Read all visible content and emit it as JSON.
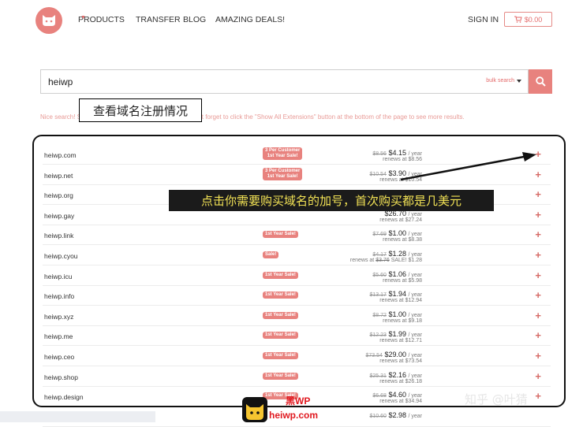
{
  "header": {
    "nav": [
      "PRODUCTS",
      "TRANSFER",
      "BLOG",
      "AMAZING DEALS!"
    ],
    "signin": "SIGN IN",
    "cart": "$0.00"
  },
  "search": {
    "value": "heiwp",
    "bulk_label": "bulk search"
  },
  "notice": "Nice search! Scroll down to see available domains or don't forget to click the \"Show All Extensions\" button at the bottom of the page to see more results.",
  "annotations": {
    "check_domain": "查看域名注册情况",
    "click_plus": "点击你需要购买域名的加号，首次购买都是几美元"
  },
  "rows": [
    {
      "domain": "heiwp.com",
      "badge": [
        "3 Per Customer",
        "1st Year Sale!"
      ],
      "old": "$8.56",
      "price": "$4.15",
      "unit": "/ year",
      "renew_prefix": "renews at ",
      "renew_old": "",
      "renew": "$8.56"
    },
    {
      "domain": "heiwp.net",
      "badge": [
        "3 Per Customer",
        "1st Year Sale!"
      ],
      "old": "$10.54",
      "price": "$3.90",
      "unit": "/ year",
      "renew_prefix": "renews at ",
      "renew_old": "",
      "renew": "$10.54"
    },
    {
      "domain": "heiwp.org",
      "badge": [],
      "old": "",
      "price": "",
      "unit": "",
      "renew_prefix": "",
      "renew_old": "",
      "renew": ""
    },
    {
      "domain": "heiwp.gay",
      "badge": [],
      "old": "",
      "price": "$26.70",
      "unit": "/ year",
      "renew_prefix": "renews at ",
      "renew_old": "",
      "renew": "$27.24"
    },
    {
      "domain": "heiwp.link",
      "badge": [
        "1st Year Sale!"
      ],
      "old": "$7.69",
      "price": "$1.00",
      "unit": "/ year",
      "renew_prefix": "renews at ",
      "renew_old": "",
      "renew": "$8.38"
    },
    {
      "domain": "heiwp.cyou",
      "badge": [
        "Sale!"
      ],
      "old": "$4.17",
      "price": "$1.28",
      "unit": "/ year",
      "renew_prefix": "renews at ",
      "renew_old": "$3.76",
      "renew": "SALE! $1.28"
    },
    {
      "domain": "heiwp.icu",
      "badge": [
        "1st Year Sale!"
      ],
      "old": "$5.60",
      "price": "$1.06",
      "unit": "/ year",
      "renew_prefix": "renews at ",
      "renew_old": "",
      "renew": "$5.98"
    },
    {
      "domain": "heiwp.info",
      "badge": [
        "1st Year Sale!"
      ],
      "old": "$13.17",
      "price": "$1.94",
      "unit": "/ year",
      "renew_prefix": "renews at ",
      "renew_old": "",
      "renew": "$12.94"
    },
    {
      "domain": "heiwp.xyz",
      "badge": [
        "1st Year Sale!"
      ],
      "old": "$8.72",
      "price": "$1.00",
      "unit": "/ year",
      "renew_prefix": "renews at ",
      "renew_old": "",
      "renew": "$9.18"
    },
    {
      "domain": "heiwp.me",
      "badge": [
        "1st Year Sale!"
      ],
      "old": "$12.23",
      "price": "$1.99",
      "unit": "/ year",
      "renew_prefix": "renews at ",
      "renew_old": "",
      "renew": "$12.71"
    },
    {
      "domain": "heiwp.ceo",
      "badge": [
        "1st Year Sale!"
      ],
      "old": "$73.54",
      "price": "$29.00",
      "unit": "/ year",
      "renew_prefix": "renews at ",
      "renew_old": "",
      "renew": "$73.54"
    },
    {
      "domain": "heiwp.shop",
      "badge": [
        "1st Year Sale!"
      ],
      "old": "$25.31",
      "price": "$2.16",
      "unit": "/ year",
      "renew_prefix": "renews at ",
      "renew_old": "",
      "renew": "$26.18"
    },
    {
      "domain": "heiwp.design",
      "badge": [
        "1st Year Sale!"
      ],
      "old": "$6.68",
      "price": "$4.60",
      "unit": "/ year",
      "renew_prefix": "renews at ",
      "renew_old": "",
      "renew": "$34.94"
    },
    {
      "domain": "",
      "badge": [],
      "old": "$10.60",
      "price": "$2.98",
      "unit": "/ year",
      "renew_prefix": "",
      "renew_old": "",
      "renew": ""
    }
  ],
  "watermark": {
    "site_cn": "黑WP",
    "site": "heiwp.com",
    "zhihu": "知乎 @叶猜"
  },
  "colors": {
    "accent": "#e8827e",
    "annotation_text": "#f2e255"
  }
}
